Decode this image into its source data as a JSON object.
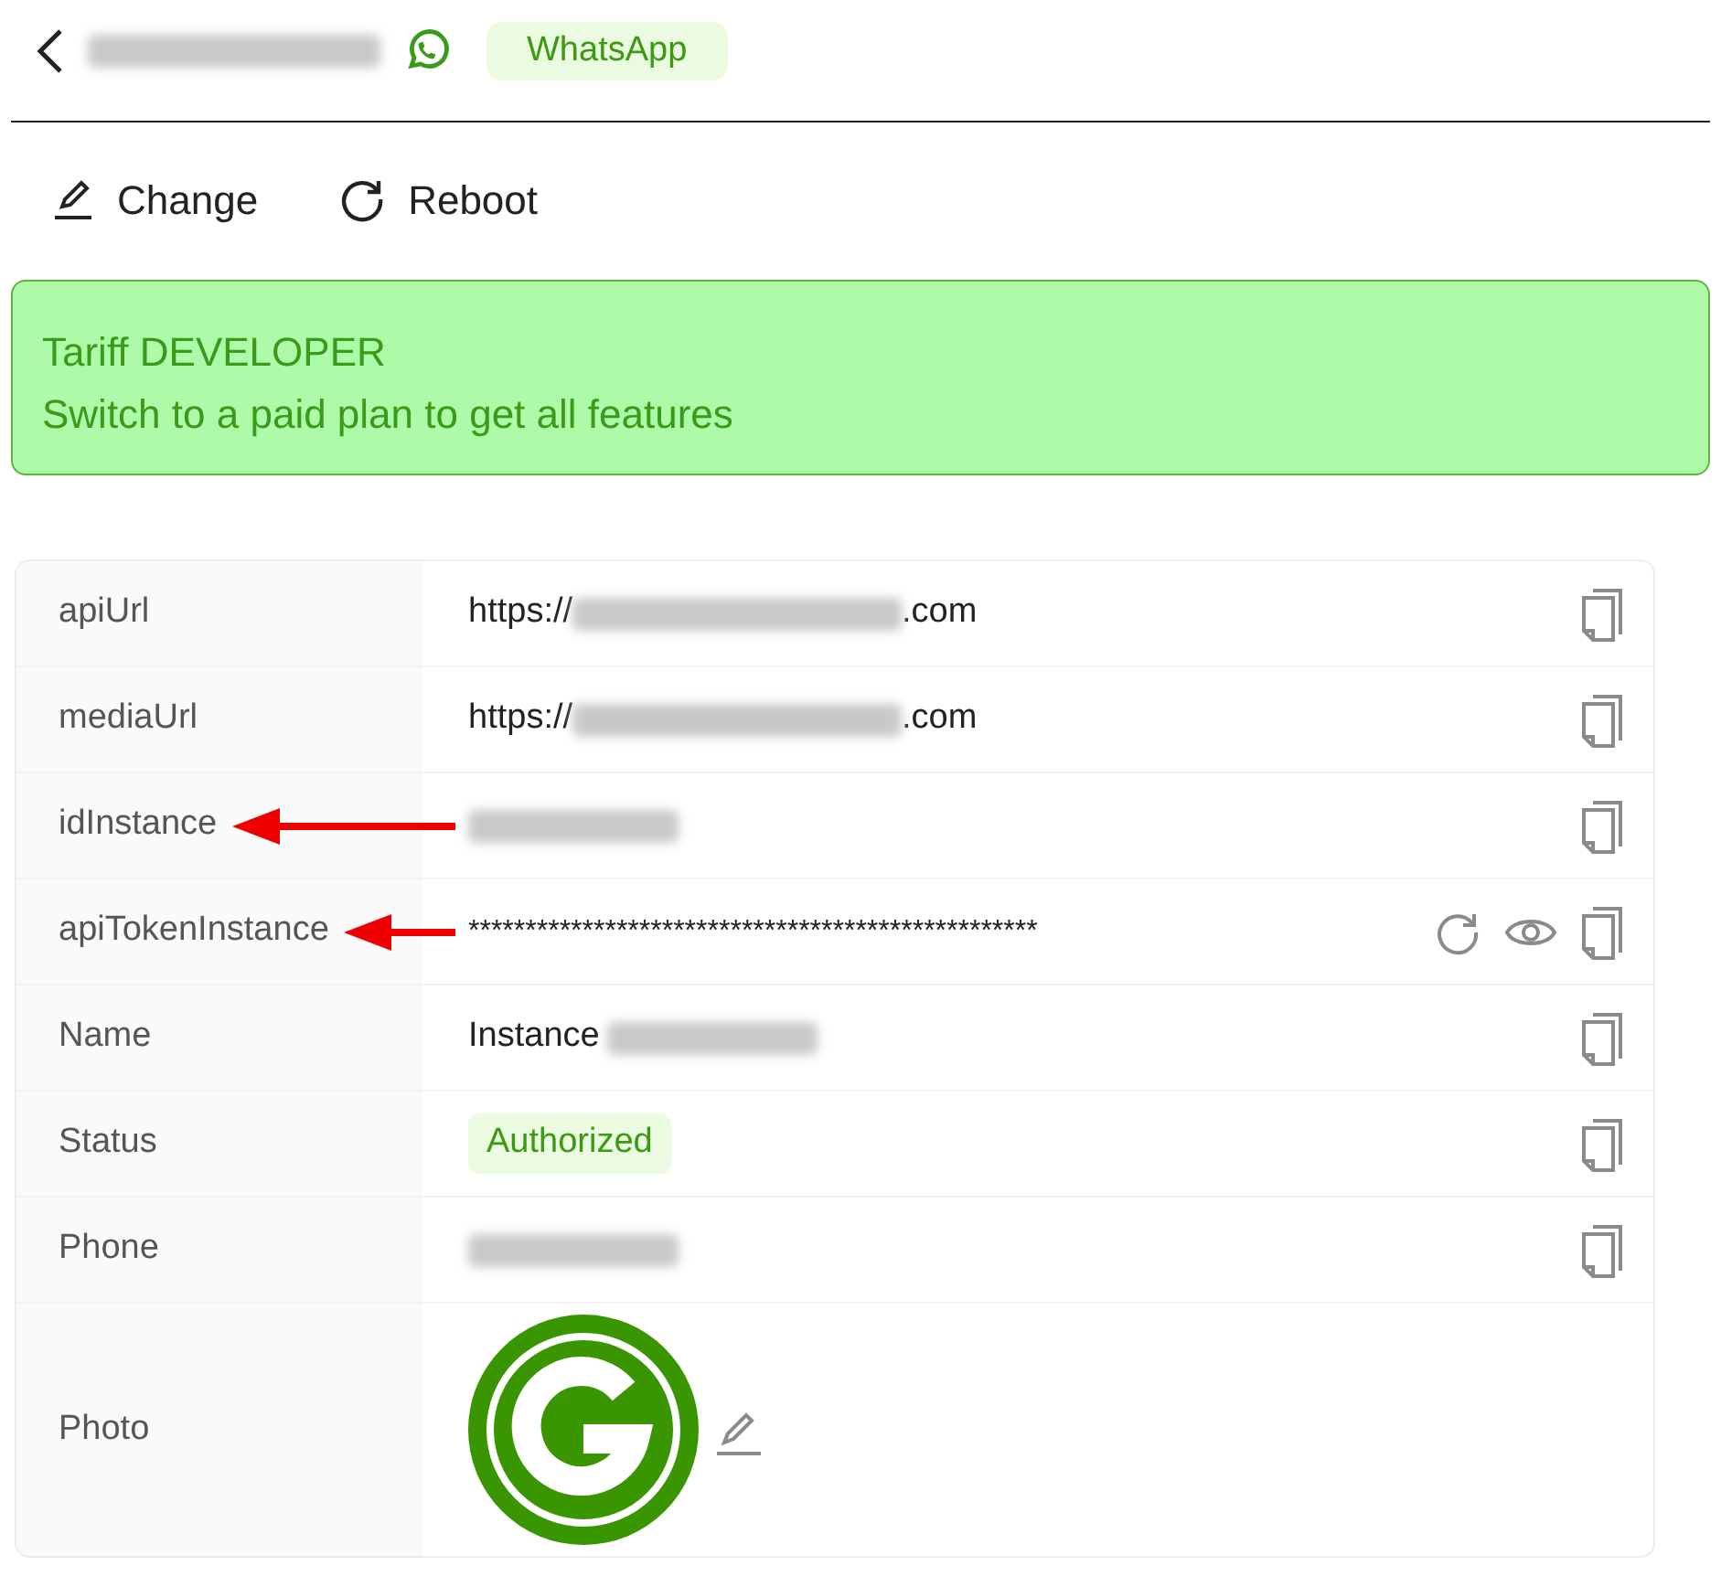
{
  "header": {
    "messenger_badge": "WhatsApp"
  },
  "actions": [
    {
      "kind": "edit",
      "label": "Change"
    },
    {
      "kind": "reboot",
      "label": "Reboot"
    }
  ],
  "tariff": {
    "title": "Tariff DEVELOPER",
    "message": "Switch to a paid plan to get all features"
  },
  "rows": [
    {
      "label": "apiUrl",
      "kind": "url",
      "prefix": "https://",
      "suffix": ".com",
      "arrow": false,
      "copyable": true,
      "revealable": false
    },
    {
      "label": "mediaUrl",
      "kind": "url",
      "prefix": "https://",
      "suffix": ".com",
      "arrow": false,
      "copyable": true,
      "revealable": false
    },
    {
      "label": "idInstance",
      "kind": "hidden",
      "arrow": true,
      "copyable": true,
      "revealable": false
    },
    {
      "label": "apiTokenInstance",
      "kind": "text",
      "value": "**************************************************",
      "arrow": true,
      "copyable": true,
      "revealable": true
    },
    {
      "label": "Name",
      "kind": "named",
      "prefix": "Instance",
      "arrow": false,
      "copyable": true,
      "revealable": false
    },
    {
      "label": "Status",
      "kind": "badge",
      "value": "Authorized",
      "arrow": false,
      "copyable": true,
      "revealable": false
    },
    {
      "label": "Phone",
      "kind": "hidden",
      "arrow": false,
      "copyable": true,
      "revealable": false
    },
    {
      "label": "Photo",
      "kind": "photo",
      "arrow": false,
      "copyable": false,
      "revealable": false
    }
  ]
}
